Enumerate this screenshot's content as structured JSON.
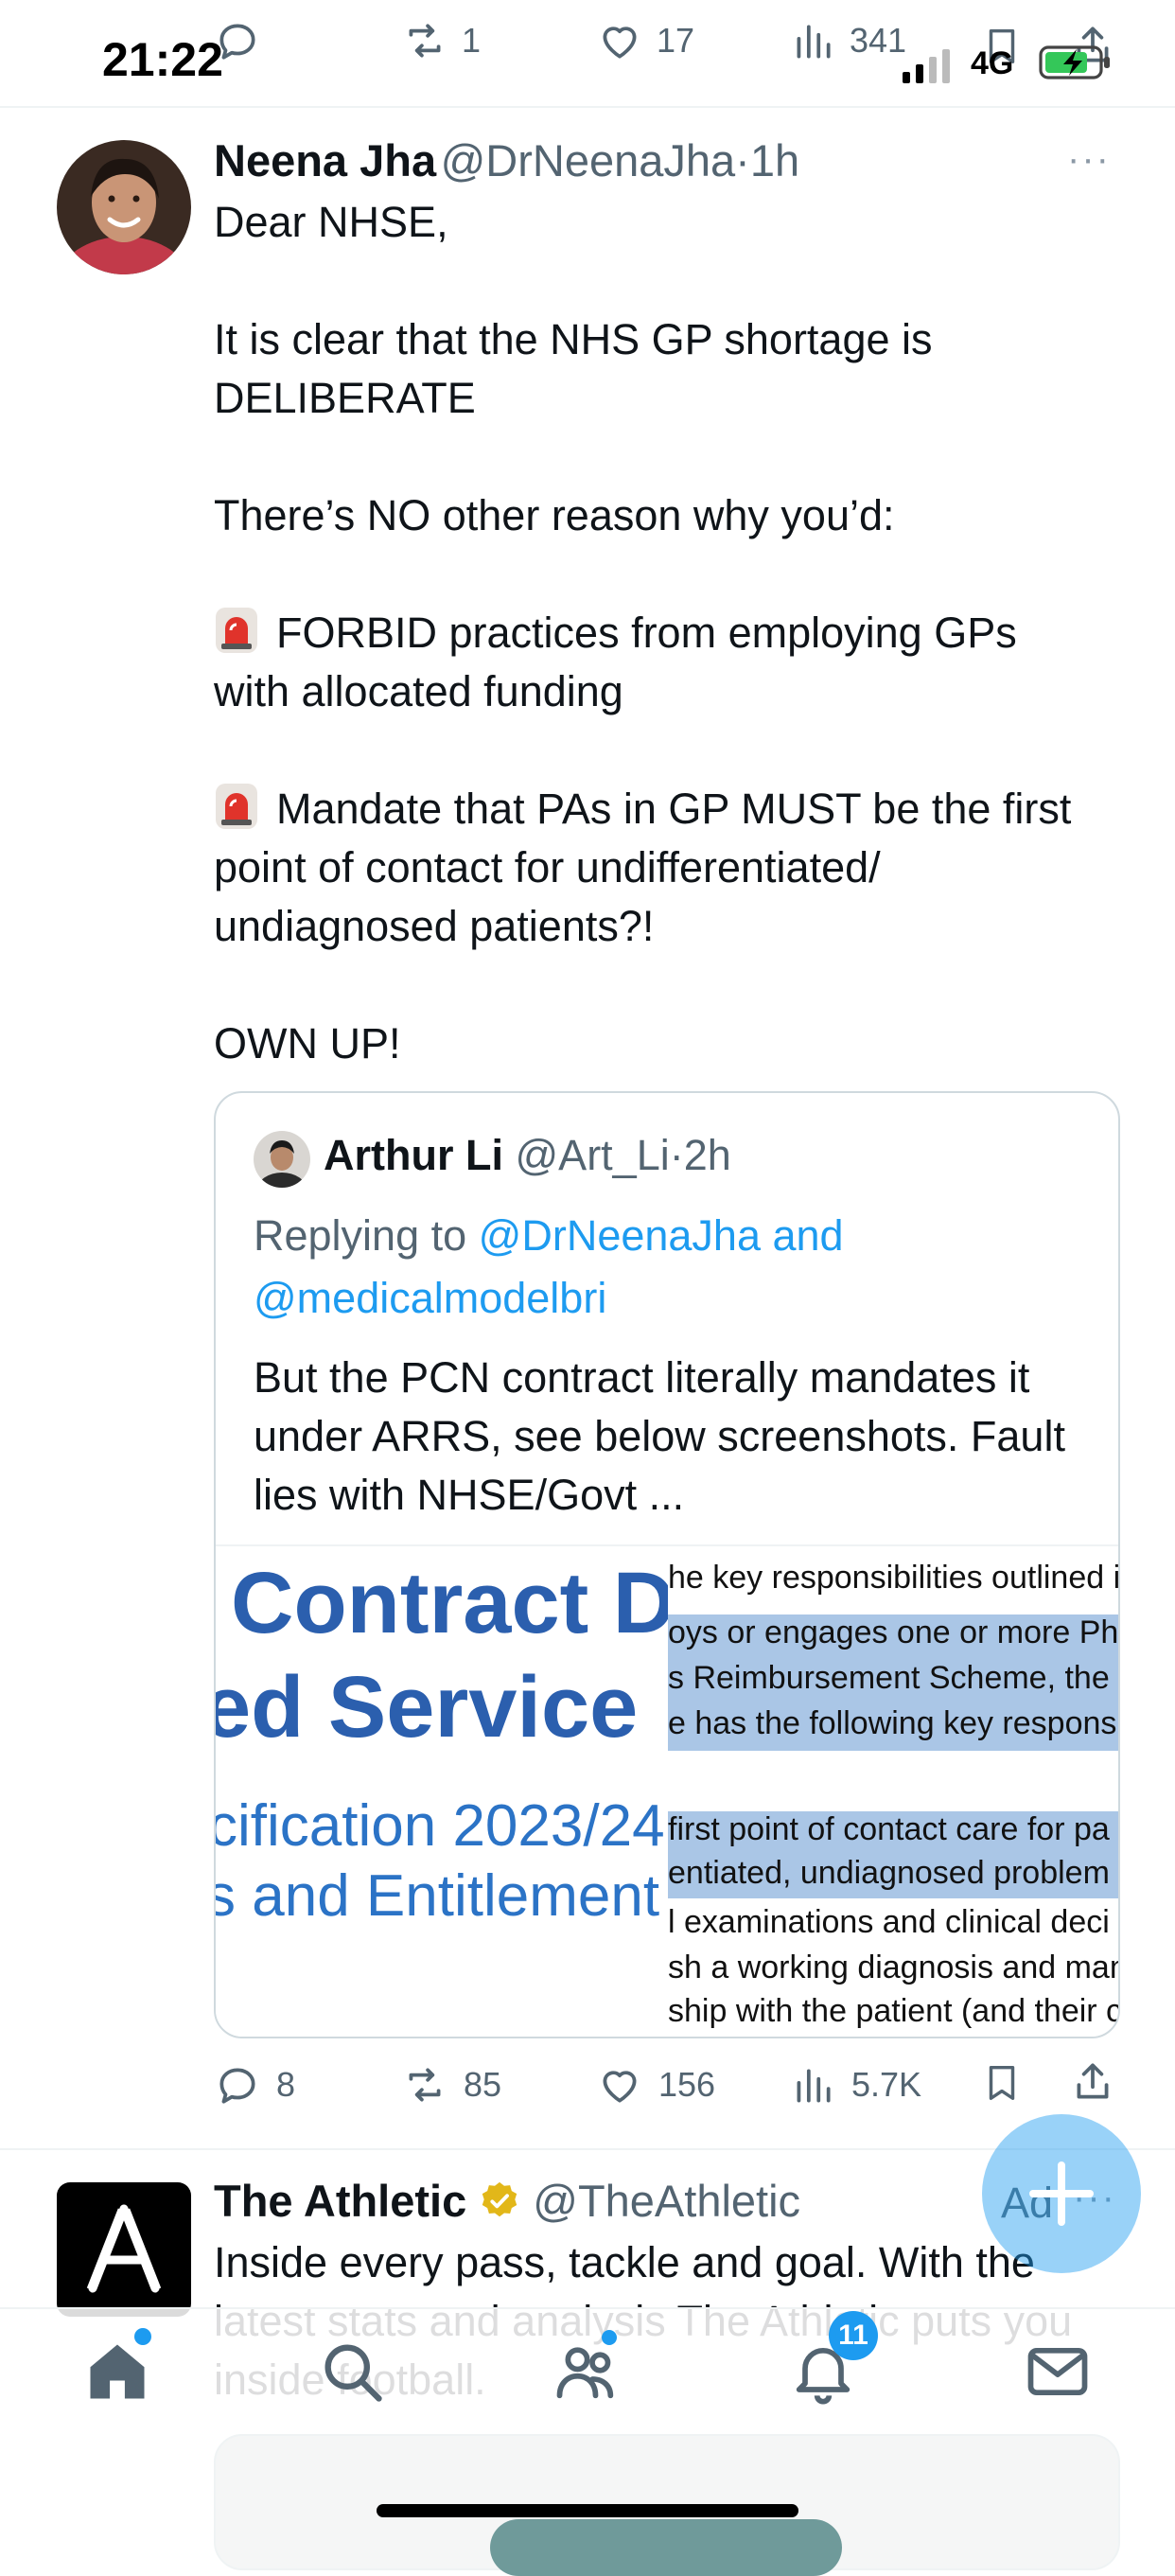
{
  "status": {
    "time": "21:22",
    "network": "4G"
  },
  "top_actions": {
    "reply": "",
    "retweets": "1",
    "likes": "17",
    "views": "341"
  },
  "tweet": {
    "author_name": "Neena Jha",
    "author_handle": "@DrNeenaJha",
    "separator": "·",
    "time": "1h",
    "more": "···",
    "body": {
      "line1": "Dear NHSE,",
      "line2": "It is clear that the NHS GP shortage is DELIBERATE",
      "line3": "There’s NO other reason why you’d:",
      "bullet1": "FORBID practices from employing GPs with allocated funding",
      "bullet2": "Mandate that PAs in GP MUST be the first point of contact for undifferentiated/ undiagnosed patients?!",
      "line4": "OWN UP!"
    }
  },
  "quote": {
    "author_name": "Arthur Li",
    "author_handle": "@Art_Li",
    "separator": "·",
    "time": "2h",
    "replying_prefix": "Replying to",
    "replying_to": "@DrNeenaJha and @medicalmodelbri",
    "text": "But the PCN contract literally mandates it under ARRS, see below screenshots. Fault lies with NHSE/Govt ...",
    "media_left": {
      "line1": "Contract D",
      "line2": "ed Service",
      "line3": "cification 2023/24",
      "line4": "s and Entitlement"
    },
    "media_right": {
      "line1": "he key responsibilities outlined in",
      "line2": "oys or engages one or more Ph",
      "line3": "s Reimbursement Scheme, the",
      "line4": "e has the following key responsi",
      "line5": "first point of contact care for pa",
      "line6": "entiated, undiagnosed problem",
      "line7": "l examinations and clinical deci",
      "line8": "sh a working diagnosis and man",
      "line9": "ship with the patient (and their c"
    }
  },
  "actions": {
    "replies": "8",
    "retweets": "85",
    "likes": "156",
    "views": "5.7K"
  },
  "promoted": {
    "author_name": "The Athletic",
    "author_handle": "@TheAthletic",
    "ad_label": "Ad",
    "more": "···",
    "text": "Inside every pass, tackle and goal. With the latest stats and analysis The Athletic puts you inside football."
  },
  "nav": {
    "notifications_badge": "11"
  },
  "colors": {
    "accent": "#1d9bf0",
    "text_primary": "#0f1419",
    "text_secondary": "#536471",
    "verified_gold": "#e2b719"
  }
}
